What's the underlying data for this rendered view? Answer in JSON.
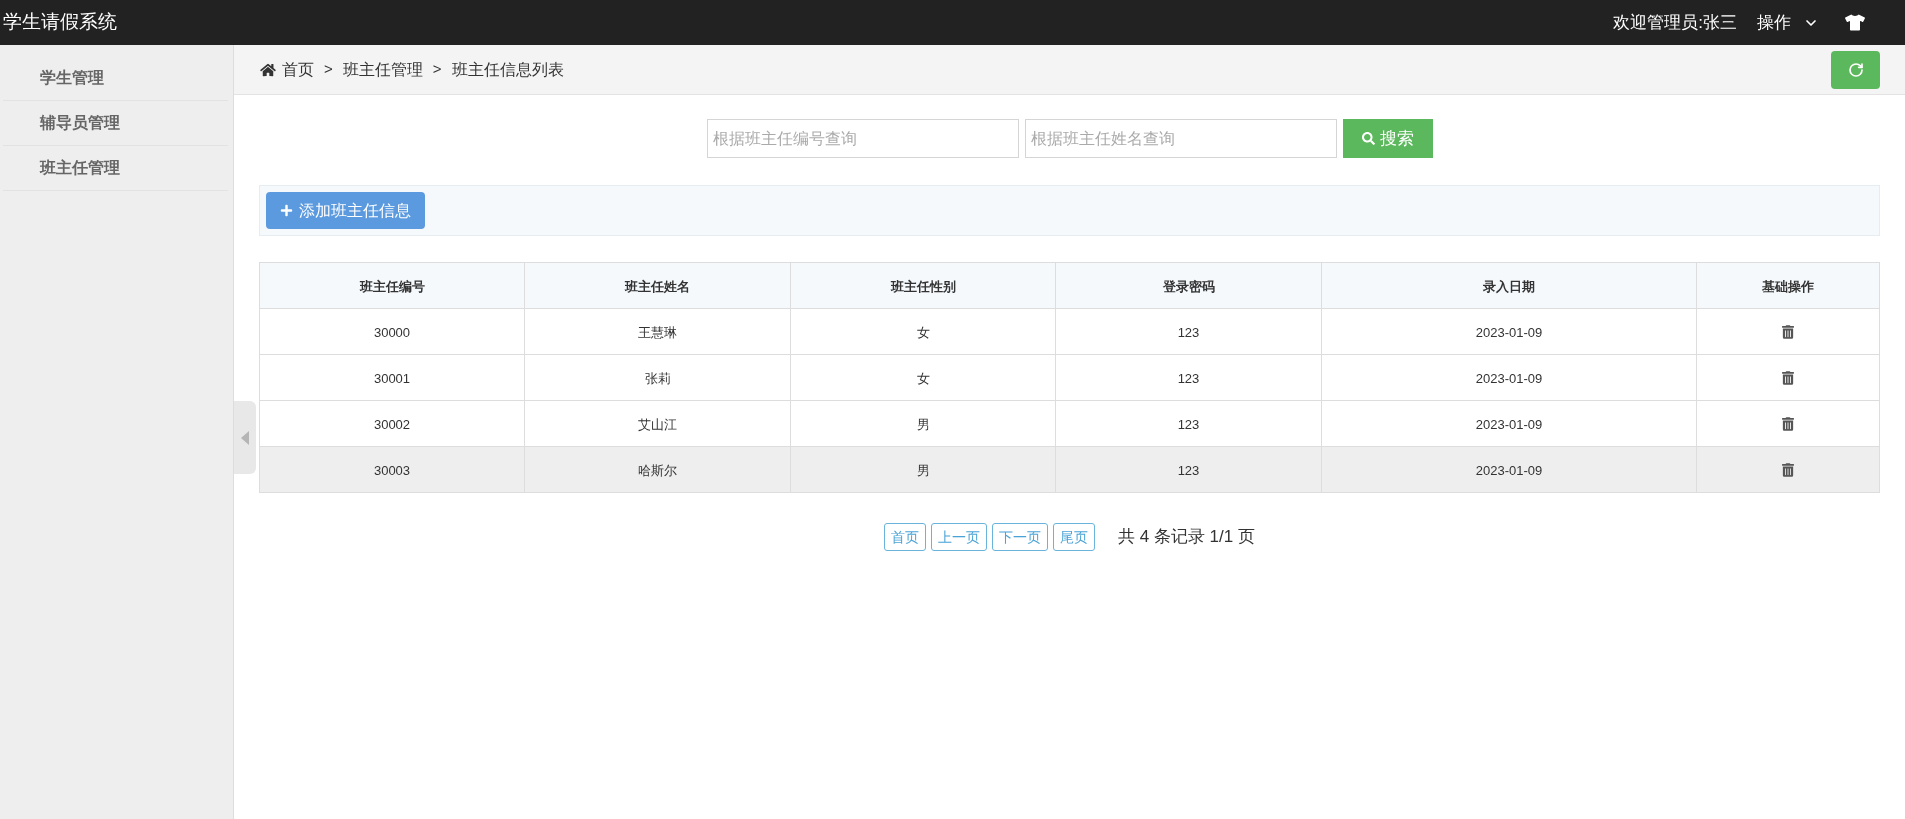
{
  "header": {
    "title": "学生请假系统",
    "welcome": "欢迎管理员:张三",
    "menu_label": "操作"
  },
  "sidebar": {
    "items": [
      {
        "label": "学生管理"
      },
      {
        "label": "辅导员管理"
      },
      {
        "label": "班主任管理"
      }
    ]
  },
  "breadcrumb": [
    {
      "kind": "home",
      "label": "首页"
    },
    {
      "kind": "separator",
      "label": ">"
    },
    {
      "kind": "link",
      "label": "班主任管理"
    },
    {
      "kind": "separator",
      "label": ">"
    },
    {
      "kind": "current",
      "label": "班主任信息列表"
    }
  ],
  "search": {
    "fields": [
      {
        "placeholder": "根据班主任编号查询"
      },
      {
        "placeholder": "根据班主任姓名查询"
      }
    ],
    "button": "搜索"
  },
  "toolbar": {
    "add_button": "添加班主任信息"
  },
  "table": {
    "columns": [
      "班主任编号",
      "班主任姓名",
      "班主任性别",
      "登录密码",
      "录入日期",
      "基础操作"
    ],
    "rows": [
      {
        "cells": [
          "30000",
          "王慧琳",
          "女",
          "123",
          "2023-01-09"
        ],
        "highlighted": false
      },
      {
        "cells": [
          "30001",
          "张莉",
          "女",
          "123",
          "2023-01-09"
        ],
        "highlighted": false
      },
      {
        "cells": [
          "30002",
          "艾山江",
          "男",
          "123",
          "2023-01-09"
        ],
        "highlighted": false
      },
      {
        "cells": [
          "30003",
          "哈斯尔",
          "男",
          "123",
          "2023-01-09"
        ],
        "highlighted": true
      }
    ]
  },
  "pagination": {
    "buttons": [
      "首页",
      "上一页",
      "下一页",
      "尾页"
    ],
    "summary": "共 4 条记录 1/1 页"
  }
}
